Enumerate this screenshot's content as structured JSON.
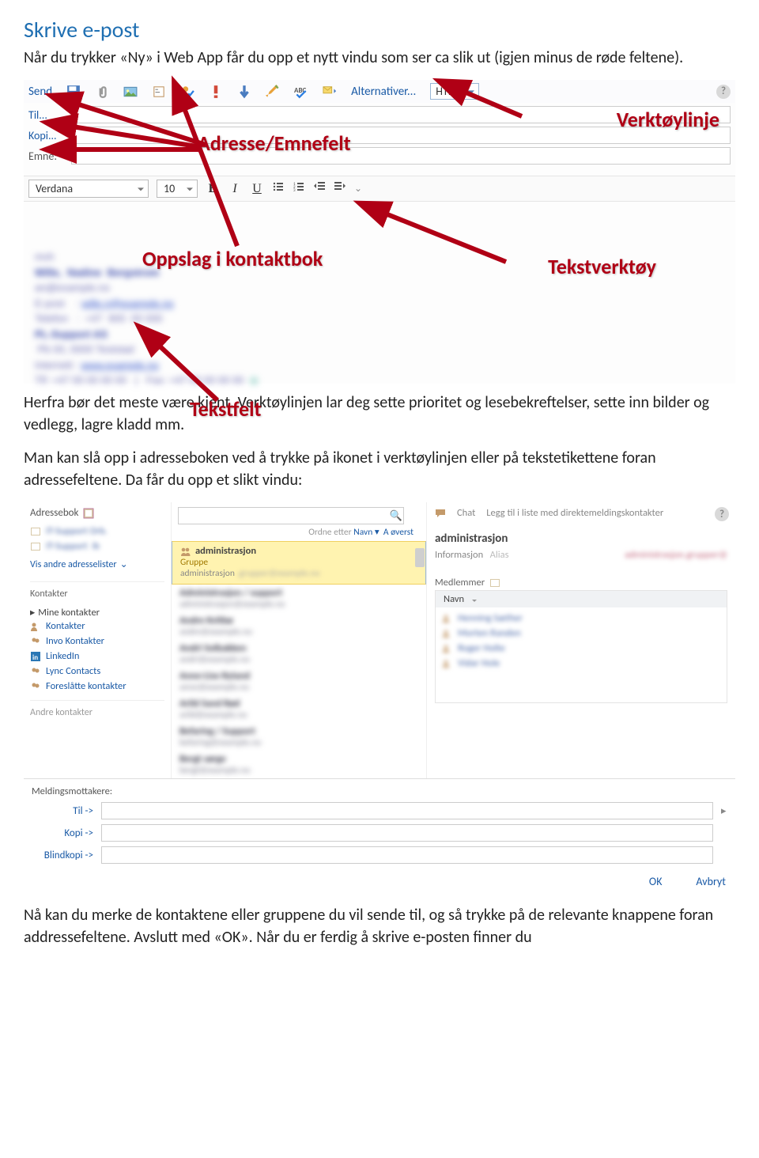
{
  "doc": {
    "heading": "Skrive e-post",
    "intro": "Når du trykker «Ny» i Web App får du opp et nytt vindu som ser ca slik ut (igjen minus de røde feltene).",
    "mid1": "Herfra bør det meste være kjent. Verktøylinjen lar deg sette prioritet og lesebekreftelser, sette inn bilder og vedlegg, lagre kladd mm.",
    "mid2": "Man kan slå opp i adresseboken ved å trykke på ikonet i verktøylinjen eller på tekstetikettene foran adressefeltene. Da får du opp et slikt vindu:",
    "outro": "Nå kan du merke de kontaktene eller gruppene du vil sende til, og så trykke på de relevante knappene foran addressefeltene. Avslutt med «OK». Når du er ferdig å skrive e-posten finner du"
  },
  "compose": {
    "send": "Send",
    "options": "Alternativer...",
    "format": "HTML",
    "to": "Til...",
    "cc": "Kopi...",
    "subject": "Emne:",
    "font": "Verdana",
    "size": "10"
  },
  "ann": {
    "toolbar": "Verktøylinje",
    "addr": "Adresse/Emnefelt",
    "lookup": "Oppslag i kontaktbok",
    "txttool": "Tekstverktøy",
    "txtfield": "Tekstfelt"
  },
  "abook": {
    "title": "Adressebok",
    "showOther": "Vis andre adresselister",
    "contactsHdr": "Kontakter",
    "myContacts": "Mine kontakter",
    "items": {
      "k": "Kontakter",
      "invo": "Invo Kontakter",
      "linkedin": "LinkedIn",
      "lync": "Lync Contacts",
      "suggested": "Foreslåtte kontakter"
    },
    "otherContacts": "Andre kontakter",
    "sortPrefix": "Ordne etter",
    "sortBy": "Navn",
    "sortDir": "A øverst",
    "selName": "administrasjon",
    "selType": "Gruppe",
    "selSub": "administrasjon",
    "rightChat": "Chat",
    "rightAdd": "Legg til i liste med direktemeldingskontakter",
    "infoTab": "Informasjon",
    "aliasTab": "Alias",
    "membersHdr": "Medlemmer",
    "nameCol": "Navn"
  },
  "recip": {
    "hdr": "Meldingsmottakere:",
    "to": "Til ->",
    "cc": "Kopi ->",
    "bcc": "Blindkopi ->",
    "ok": "OK",
    "cancel": "Avbryt"
  }
}
